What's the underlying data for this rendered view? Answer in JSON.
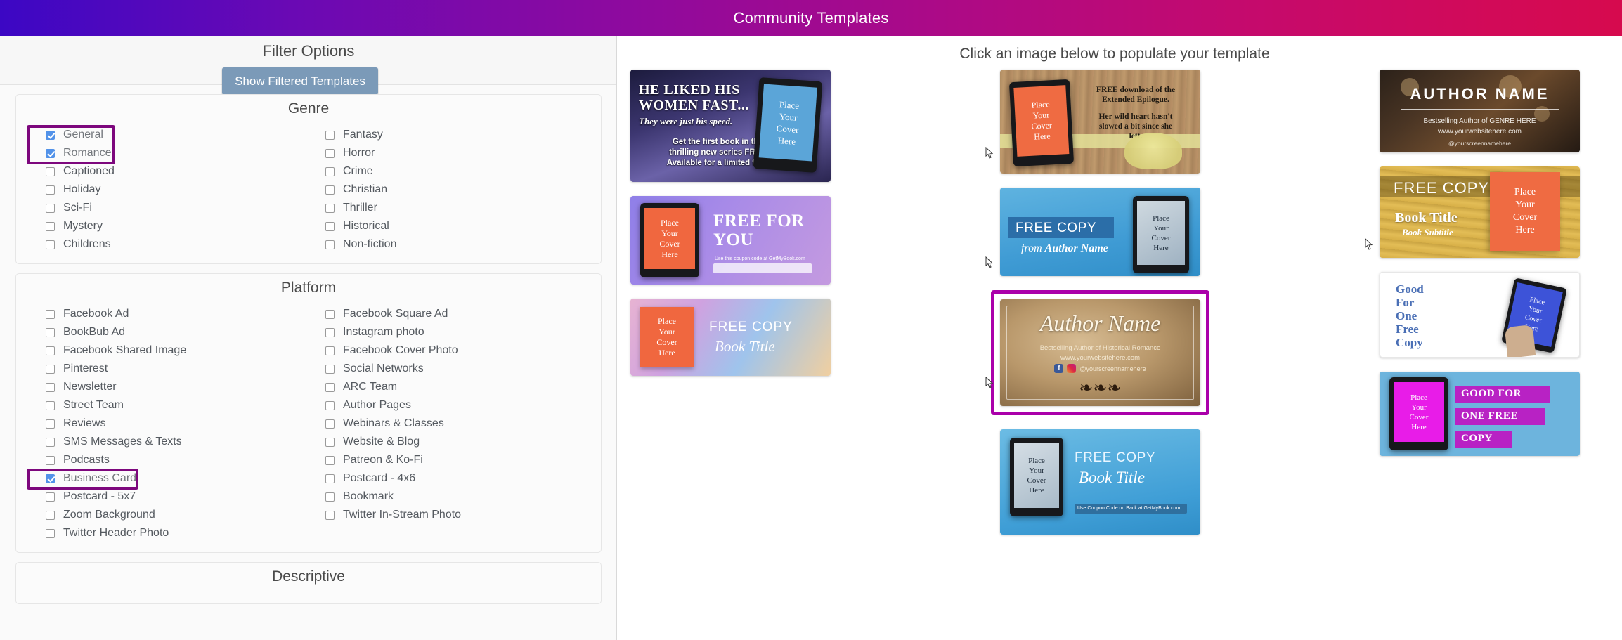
{
  "window": {
    "title": "Community Templates"
  },
  "left_panel": {
    "filter_title": "Filter Options",
    "show_filtered_button": "Show Filtered Templates",
    "sections": [
      {
        "title": "Genre",
        "left_items": [
          {
            "label": "General",
            "checked": true
          },
          {
            "label": "Romance",
            "checked": true
          },
          {
            "label": "Captioned",
            "checked": false
          },
          {
            "label": "Holiday",
            "checked": false
          },
          {
            "label": "Sci-Fi",
            "checked": false
          },
          {
            "label": "Mystery",
            "checked": false
          },
          {
            "label": "Childrens",
            "checked": false
          }
        ],
        "right_items": [
          {
            "label": "Fantasy",
            "checked": false
          },
          {
            "label": "Horror",
            "checked": false
          },
          {
            "label": "Crime",
            "checked": false
          },
          {
            "label": "Christian",
            "checked": false
          },
          {
            "label": "Thriller",
            "checked": false
          },
          {
            "label": "Historical",
            "checked": false
          },
          {
            "label": "Non-fiction",
            "checked": false
          }
        ]
      },
      {
        "title": "Platform",
        "left_items": [
          {
            "label": "Facebook Ad",
            "checked": false
          },
          {
            "label": "BookBub Ad",
            "checked": false
          },
          {
            "label": "Facebook Shared Image",
            "checked": false
          },
          {
            "label": "Pinterest",
            "checked": false
          },
          {
            "label": "Newsletter",
            "checked": false
          },
          {
            "label": "Street Team",
            "checked": false
          },
          {
            "label": "Reviews",
            "checked": false
          },
          {
            "label": "SMS Messages & Texts",
            "checked": false
          },
          {
            "label": "Podcasts",
            "checked": false
          },
          {
            "label": "Business Card",
            "checked": true
          },
          {
            "label": "Postcard - 5x7",
            "checked": false
          },
          {
            "label": "Zoom Background",
            "checked": false
          },
          {
            "label": "Twitter Header Photo",
            "checked": false
          }
        ],
        "right_items": [
          {
            "label": "Facebook Square Ad",
            "checked": false
          },
          {
            "label": "Instagram photo",
            "checked": false
          },
          {
            "label": "Facebook Cover Photo",
            "checked": false
          },
          {
            "label": "Social Networks",
            "checked": false
          },
          {
            "label": "ARC Team",
            "checked": false
          },
          {
            "label": "Author Pages",
            "checked": false
          },
          {
            "label": "Webinars & Classes",
            "checked": false
          },
          {
            "label": "Website & Blog",
            "checked": false
          },
          {
            "label": "Patreon & Ko-Fi",
            "checked": false
          },
          {
            "label": "Postcard - 4x6",
            "checked": false
          },
          {
            "label": "Bookmark",
            "checked": false
          },
          {
            "label": "Twitter In-Stream Photo",
            "checked": false
          }
        ]
      },
      {
        "title": "Descriptive",
        "left_items": [],
        "right_items": []
      }
    ],
    "highlight_color": "#7d077d"
  },
  "right_panel": {
    "instruction": "Click an image below to populate your template",
    "selected_border_color": "#aa00aa",
    "templates": {
      "col_a": [
        {
          "name": "he-liked-his-women-fast",
          "headline": "HE LIKED HIS\nWOMEN FAST...",
          "subhead": "They were just his speed.",
          "body": "Get the first book in this\nthrilling new series FREE!\nAvailable for a limited time.",
          "cover_placeholder": "Place\nYour\nCover\nHere"
        },
        {
          "name": "free-for-you-purple",
          "headline": "FREE FOR\nYOU",
          "body": "Use this coupon code at GetMyBook.com",
          "cover_placeholder": "Place\nYour\nCover\nHere"
        },
        {
          "name": "free-copy-book-title-watercolor",
          "headline": "FREE COPY",
          "subhead": "Book Title",
          "cover_placeholder": "Place\nYour\nCover\nHere"
        }
      ],
      "col_b": [
        {
          "name": "extended-epilogue-wood",
          "headline": "FREE download of the\nExtended Epilogue.",
          "body": "Her wild heart hasn't\nslowed a bit since she\nleft.",
          "cover_placeholder": "Place\nYour\nCover\nHere"
        },
        {
          "name": "free-copy-from-author-name-blue",
          "headline": "FREE COPY",
          "subhead": "from Author Name",
          "cover_placeholder": "Place\nYour\nCover\nHere"
        },
        {
          "name": "author-name-parchment-business-card",
          "selected": true,
          "headline": "Author Name",
          "subhead": "Bestselling Author of Historical Romance",
          "website": "www.yourwebsitehere.com",
          "handle": "@yourscreennamehere"
        },
        {
          "name": "free-copy-book-title-blue",
          "headline": "FREE COPY",
          "subhead": "Book Title",
          "body": "Use Coupon Code on Back at GetMyBook.com",
          "cover_placeholder": "Place\nYour\nCover\nHere"
        }
      ],
      "col_c": [
        {
          "name": "author-name-bokeh",
          "headline": "AUTHOR NAME",
          "subhead": "Bestselling Author of GENRE HERE",
          "website": "www.yourwebsitehere.com",
          "handle": "@yourscreennamehere"
        },
        {
          "name": "free-copy-book-title-yellow-wood",
          "headline": "FREE COPY",
          "subhead": "Book Title",
          "subsubhead": "Book Subtitle",
          "cover_placeholder": "Place\nYour\nCover\nHere"
        },
        {
          "name": "good-for-one-free-copy-white",
          "headline": "Good\nFor\nOne\nFree\nCopy",
          "cover_placeholder": "Place\nYour\nCover\nHere"
        },
        {
          "name": "good-for-one-free-copy-blue",
          "headline_lines": [
            "GOOD FOR",
            "ONE FREE",
            "COPY"
          ],
          "cover_placeholder": "Place\nYour\nCover\nHere"
        }
      ]
    }
  }
}
